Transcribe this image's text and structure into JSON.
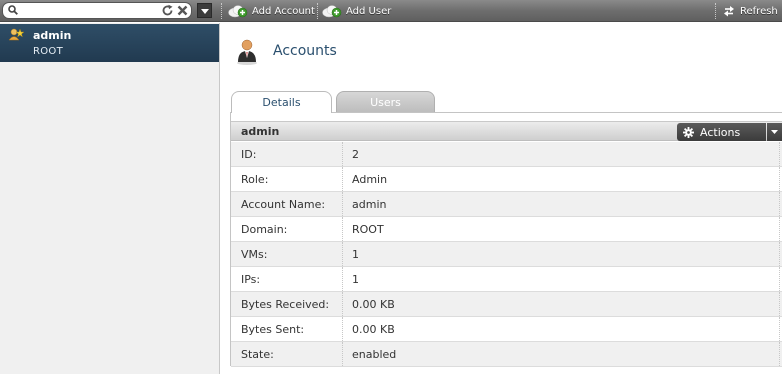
{
  "toolbar": {
    "search": {
      "placeholder": "",
      "value": ""
    },
    "add_account_label": "Add Account",
    "add_user_label": "Add User",
    "refresh_label": "Refresh"
  },
  "sidebar": {
    "items": [
      {
        "name": "admin",
        "domain": "ROOT",
        "selected": true
      }
    ]
  },
  "main": {
    "title": "Accounts",
    "tabs": [
      {
        "label": "Details",
        "active": true
      },
      {
        "label": "Users",
        "active": false
      }
    ],
    "panel": {
      "title": "admin",
      "actions_label": "Actions",
      "rows": [
        {
          "label": "ID:",
          "value": "2"
        },
        {
          "label": "Role:",
          "value": "Admin"
        },
        {
          "label": "Account Name:",
          "value": "admin"
        },
        {
          "label": "Domain:",
          "value": "ROOT"
        },
        {
          "label": "VMs:",
          "value": "1"
        },
        {
          "label": "IPs:",
          "value": "1"
        },
        {
          "label": "Bytes Received:",
          "value": "0.00 KB"
        },
        {
          "label": "Bytes Sent:",
          "value": "0.00 KB"
        },
        {
          "label": "State:",
          "value": "enabled"
        }
      ]
    }
  },
  "colors": {
    "toolbar_bg": "#6e6e6e",
    "sidebar_selected": "#2a4560",
    "title_text": "#2a4f6e",
    "actions_bg": "#4a4a4a"
  },
  "icons": [
    "search-icon",
    "reload-icon",
    "clear-icon",
    "chevron-down-icon",
    "add-cloud-icon",
    "refresh-icon",
    "user-icon",
    "account-person-icon",
    "gear-icon"
  ]
}
